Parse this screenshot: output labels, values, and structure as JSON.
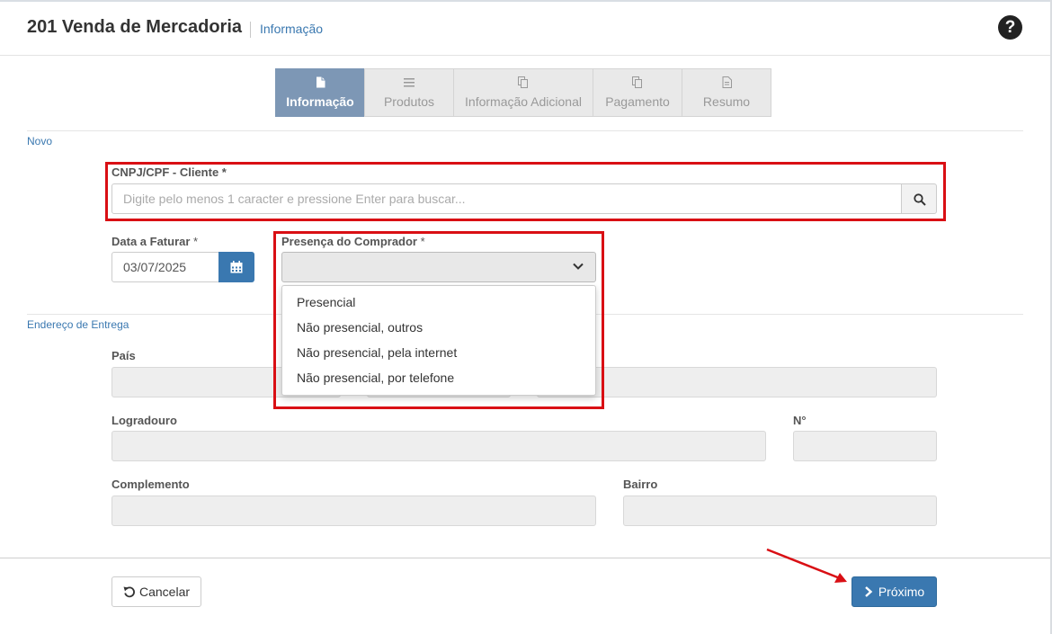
{
  "header": {
    "title": "201 Venda de Mercadoria",
    "subtitle": "Informação",
    "help_icon": "question-circle-icon"
  },
  "wizard": {
    "steps": [
      {
        "label": "Informação",
        "icon": "file-icon",
        "active": true
      },
      {
        "label": "Produtos",
        "icon": "list-icon",
        "active": false
      },
      {
        "label": "Informação Adicional",
        "icon": "copy-icon",
        "active": false
      },
      {
        "label": "Pagamento",
        "icon": "copy-icon",
        "active": false
      },
      {
        "label": "Resumo",
        "icon": "file-text-icon",
        "active": false
      }
    ]
  },
  "section_novo": "Novo",
  "cliente": {
    "label": "CNPJ/CPF - Cliente *",
    "placeholder": "Digite pelo menos 1 caracter e pressione Enter para buscar...",
    "search_icon": "search-icon"
  },
  "data_faturar": {
    "label": "Data a Faturar",
    "required_mark": "*",
    "value": "03/07/2025",
    "calendar_icon": "calendar-icon"
  },
  "presenca": {
    "label": "Presença do Comprador",
    "required_mark": "*",
    "selected": "",
    "options": [
      "Presencial",
      "Não presencial, outros",
      "Não presencial, pela internet",
      "Não presencial, por telefone"
    ]
  },
  "section_endereco": "Endereço de Entrega",
  "endereco": {
    "pais_label": "País",
    "logradouro_label": "Logradouro",
    "numero_label": "N°",
    "complemento_label": "Complemento",
    "bairro_label": "Bairro"
  },
  "footer": {
    "cancel_label": "Cancelar",
    "next_label": "Próximo"
  },
  "colors": {
    "accent": "#3a78b0",
    "highlight": "#d90f14",
    "active_step": "#7d97b5"
  }
}
